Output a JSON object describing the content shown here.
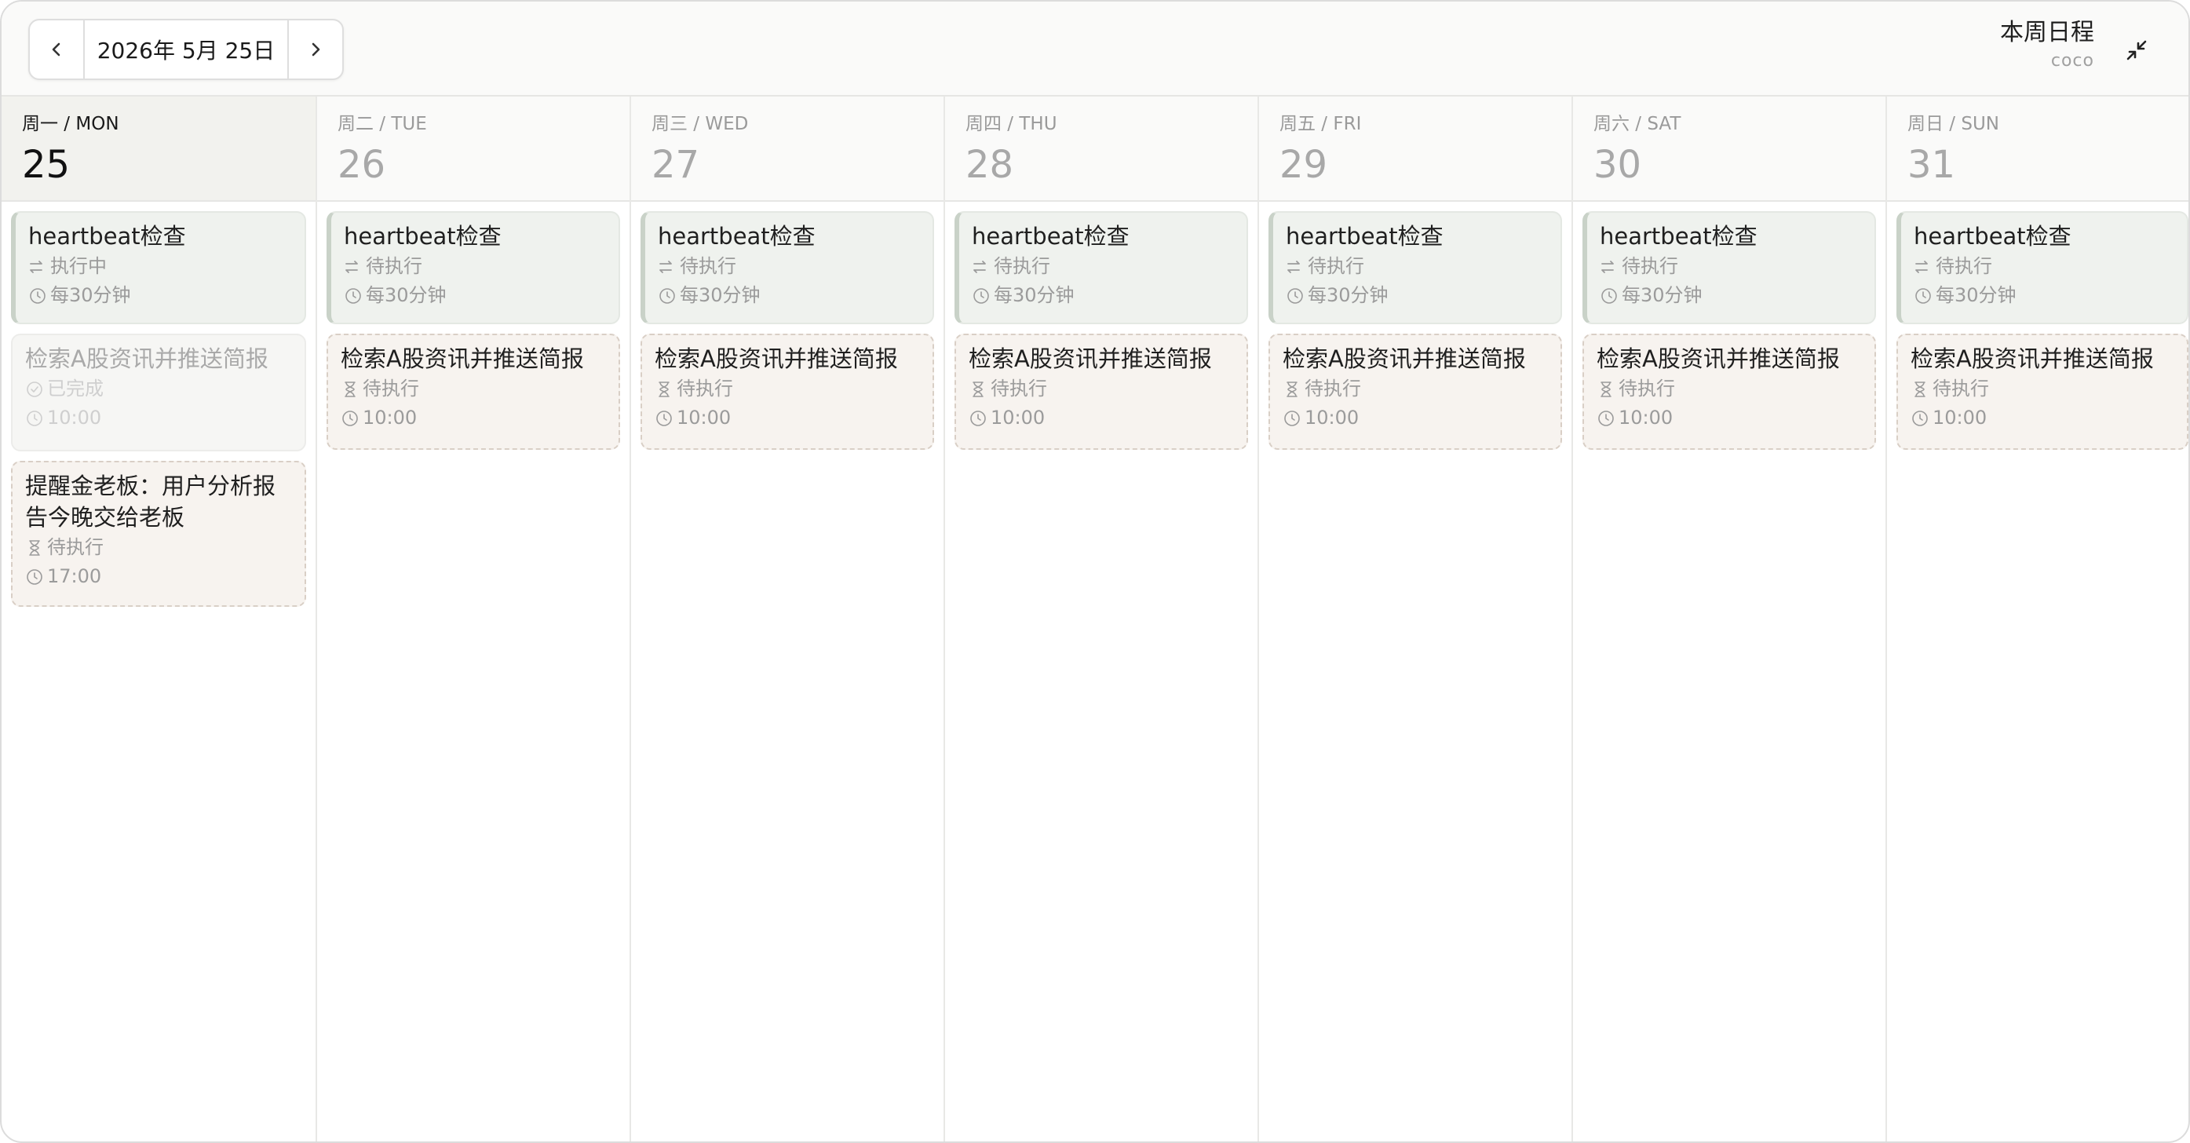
{
  "header": {
    "prev_label": "<",
    "next_label": ">",
    "date_label": "2026年 5月 25日",
    "title": "本周日程",
    "subtitle": "coco",
    "collapse_icon": "collapse-arrows-icon"
  },
  "colors": {
    "recurring_bg": "#eff2ee",
    "pending_bg": "#f7f3ef",
    "pending_border": "#d9cfc6",
    "today_header_bg": "#f2f2ee"
  },
  "days": [
    {
      "weekday": "周一 / MON",
      "date": "25",
      "today": true,
      "tasks": [
        {
          "kind": "recurring",
          "title": "heartbeat检查",
          "status": "执行中",
          "status_icon": "repeat-icon",
          "schedule": "每30分钟"
        },
        {
          "kind": "done",
          "title": "检索A股资讯并推送简报",
          "status": "已完成",
          "status_icon": "check-circle-icon",
          "schedule": "10:00"
        },
        {
          "kind": "pending",
          "title": "提醒金老板：用户分析报告今晚交给老板",
          "status": "待执行",
          "status_icon": "hourglass-icon",
          "schedule": "17:00",
          "tall": true
        }
      ]
    },
    {
      "weekday": "周二 / TUE",
      "date": "26",
      "today": false,
      "tasks": [
        {
          "kind": "recurring",
          "title": "heartbeat检查",
          "status": "待执行",
          "status_icon": "repeat-icon",
          "schedule": "每30分钟"
        },
        {
          "kind": "pending",
          "title": "检索A股资讯并推送简报",
          "status": "待执行",
          "status_icon": "hourglass-icon",
          "schedule": "10:00"
        }
      ]
    },
    {
      "weekday": "周三 / WED",
      "date": "27",
      "today": false,
      "tasks": [
        {
          "kind": "recurring",
          "title": "heartbeat检查",
          "status": "待执行",
          "status_icon": "repeat-icon",
          "schedule": "每30分钟"
        },
        {
          "kind": "pending",
          "title": "检索A股资讯并推送简报",
          "status": "待执行",
          "status_icon": "hourglass-icon",
          "schedule": "10:00"
        }
      ]
    },
    {
      "weekday": "周四 / THU",
      "date": "28",
      "today": false,
      "tasks": [
        {
          "kind": "recurring",
          "title": "heartbeat检查",
          "status": "待执行",
          "status_icon": "repeat-icon",
          "schedule": "每30分钟"
        },
        {
          "kind": "pending",
          "title": "检索A股资讯并推送简报",
          "status": "待执行",
          "status_icon": "hourglass-icon",
          "schedule": "10:00"
        }
      ]
    },
    {
      "weekday": "周五 / FRI",
      "date": "29",
      "today": false,
      "tasks": [
        {
          "kind": "recurring",
          "title": "heartbeat检查",
          "status": "待执行",
          "status_icon": "repeat-icon",
          "schedule": "每30分钟"
        },
        {
          "kind": "pending",
          "title": "检索A股资讯并推送简报",
          "status": "待执行",
          "status_icon": "hourglass-icon",
          "schedule": "10:00"
        }
      ]
    },
    {
      "weekday": "周六 / SAT",
      "date": "30",
      "today": false,
      "tasks": [
        {
          "kind": "recurring",
          "title": "heartbeat检查",
          "status": "待执行",
          "status_icon": "repeat-icon",
          "schedule": "每30分钟"
        },
        {
          "kind": "pending",
          "title": "检索A股资讯并推送简报",
          "status": "待执行",
          "status_icon": "hourglass-icon",
          "schedule": "10:00"
        }
      ]
    },
    {
      "weekday": "周日 / SUN",
      "date": "31",
      "today": false,
      "tasks": [
        {
          "kind": "recurring",
          "title": "heartbeat检查",
          "status": "待执行",
          "status_icon": "repeat-icon",
          "schedule": "每30分钟"
        },
        {
          "kind": "pending",
          "title": "检索A股资讯并推送简报",
          "status": "待执行",
          "status_icon": "hourglass-icon",
          "schedule": "10:00"
        }
      ]
    }
  ]
}
